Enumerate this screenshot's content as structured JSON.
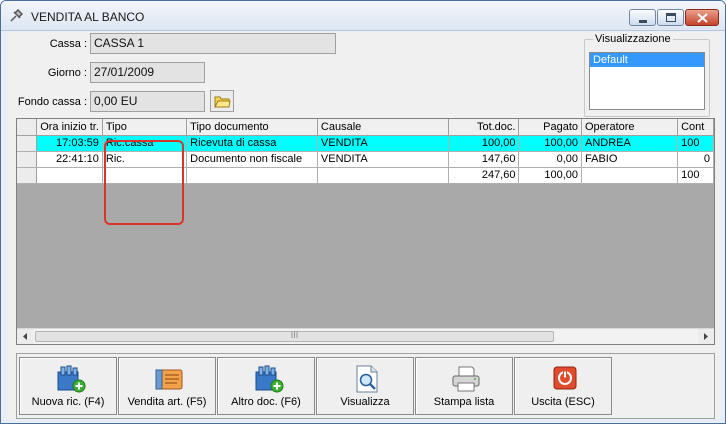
{
  "window": {
    "title": "VENDITA AL BANCO"
  },
  "form": {
    "cassa_label": "Cassa :",
    "cassa_value": "CASSA 1",
    "giorno_label": "Giorno :",
    "giorno_value": "27/01/2009",
    "fondo_label": "Fondo cassa :",
    "fondo_value": "0,00 EU"
  },
  "visualizzazione": {
    "legend": "Visualizzazione",
    "selected": "Default"
  },
  "grid": {
    "columns": [
      "Ora inizio tr.",
      "Tipo",
      "Tipo documento",
      "Causale",
      "Tot.doc.",
      "Pagato",
      "Operatore",
      "Cont"
    ],
    "rows": [
      [
        "17:03:59",
        "Ric.cassa",
        "Ricevuta di cassa",
        "VENDITA",
        "100,00",
        "100,00",
        "ANDREA",
        "100"
      ],
      [
        "22:41:10",
        "Ric.",
        "Documento non fiscale",
        "VENDITA",
        "147,60",
        "0,00",
        "FABIO",
        "0"
      ]
    ],
    "totals": [
      "",
      "",
      "",
      "",
      "247,60",
      "100,00",
      "",
      "100"
    ],
    "scroll_center": "III"
  },
  "buttons": [
    {
      "label": "Nuova ric. (F4)",
      "icon": "new-receipt-icon"
    },
    {
      "label": "Vendita art. (F5)",
      "icon": "sell-item-icon"
    },
    {
      "label": "Altro doc. (F6)",
      "icon": "other-doc-icon"
    },
    {
      "label": "Visualizza",
      "icon": "view-document-icon"
    },
    {
      "label": "Stampa lista",
      "icon": "printer-icon"
    },
    {
      "label": "Uscita (ESC)",
      "icon": "exit-icon"
    }
  ],
  "colors": {
    "selected_row": "#00ffff",
    "highlight": "#d9342b",
    "list_selection": "#3399ff"
  }
}
